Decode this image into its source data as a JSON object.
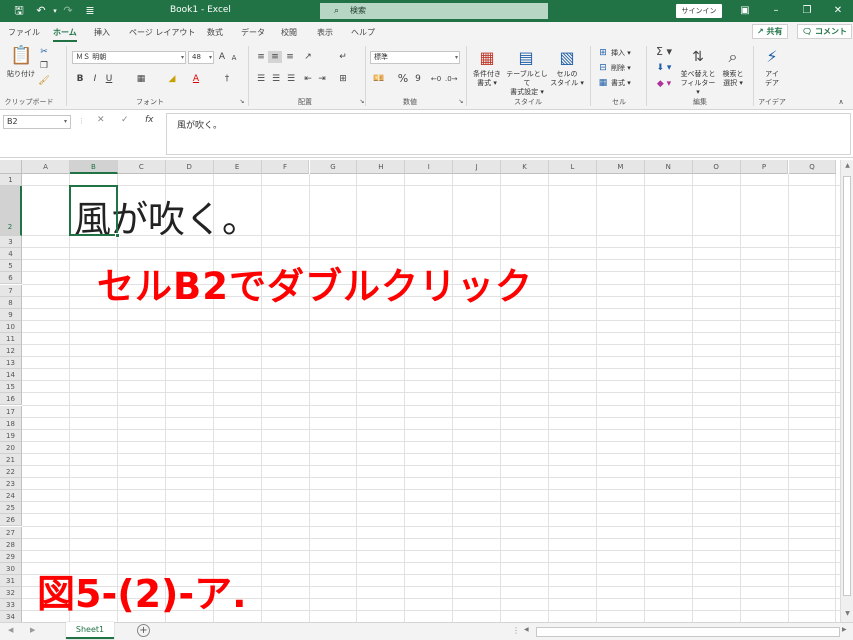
{
  "titlebar": {
    "title": "Book1  -  Excel",
    "search_placeholder": "検索",
    "signin_label": "サインイン",
    "icons": [
      "save-icon",
      "undo-icon",
      "redo-icon",
      "customize-qat-icon"
    ]
  },
  "ribbon_tabs": [
    "ファイル",
    "ホーム",
    "挿入",
    "ページ レイアウト",
    "数式",
    "データ",
    "校閲",
    "表示",
    "ヘルプ"
  ],
  "active_tab": "ホーム",
  "share_label": "共有",
  "comment_label": "コメント",
  "clipboard": {
    "paste_label": "貼り付け",
    "group_label": "クリップボード"
  },
  "font": {
    "name": "ＭＳ 明朝",
    "size": "48",
    "group_label": "フォント",
    "bold": "B",
    "italic": "I",
    "underline": "U",
    "grow": "A",
    "shrink": "A"
  },
  "alignment": {
    "group_label": "配置"
  },
  "number": {
    "format": "標準",
    "group_label": "数値",
    "percent": "%",
    "comma": "9"
  },
  "styles": {
    "conditional_label": [
      "条件付き",
      "書式"
    ],
    "table_label": [
      "テーブルとして",
      "書式設定"
    ],
    "cellstyle_label": [
      "セルの",
      "スタイル"
    ],
    "group_label": "スタイル"
  },
  "cells": {
    "insert_label": "挿入",
    "delete_label": "削除",
    "format_label": "書式",
    "group_label": "セル"
  },
  "editing": {
    "sort_label": [
      "並べ替えと",
      "フィルター"
    ],
    "find_label": [
      "検索と",
      "選択"
    ],
    "group_label": "編集"
  },
  "ideas": {
    "label": [
      "アイ",
      "デア"
    ],
    "group_label": "アイデア"
  },
  "formula_bar": {
    "name_box": "B2",
    "content": "風が吹く。"
  },
  "grid": {
    "columns": [
      "A",
      "B",
      "C",
      "D",
      "E",
      "F",
      "G",
      "H",
      "I",
      "J",
      "K",
      "L",
      "M",
      "N",
      "O",
      "P",
      "Q"
    ],
    "rows": [
      "1",
      "2",
      "3",
      "4",
      "5",
      "6",
      "7",
      "8",
      "9",
      "10",
      "11",
      "12",
      "13",
      "14",
      "15",
      "16",
      "17",
      "18",
      "19",
      "20",
      "21",
      "22",
      "23",
      "24",
      "25",
      "26",
      "27",
      "28",
      "29",
      "30",
      "31",
      "32",
      "33",
      "34"
    ],
    "selected_cell": "B2",
    "b2_text": "風が吹く。"
  },
  "annotation": {
    "instruction": "セルB2でダブルクリック",
    "figure_label": "図5-(2)-ア."
  },
  "sheet": {
    "tab": "Sheet1"
  },
  "colors": {
    "accent": "#217346",
    "annotation": "#ff0000"
  }
}
